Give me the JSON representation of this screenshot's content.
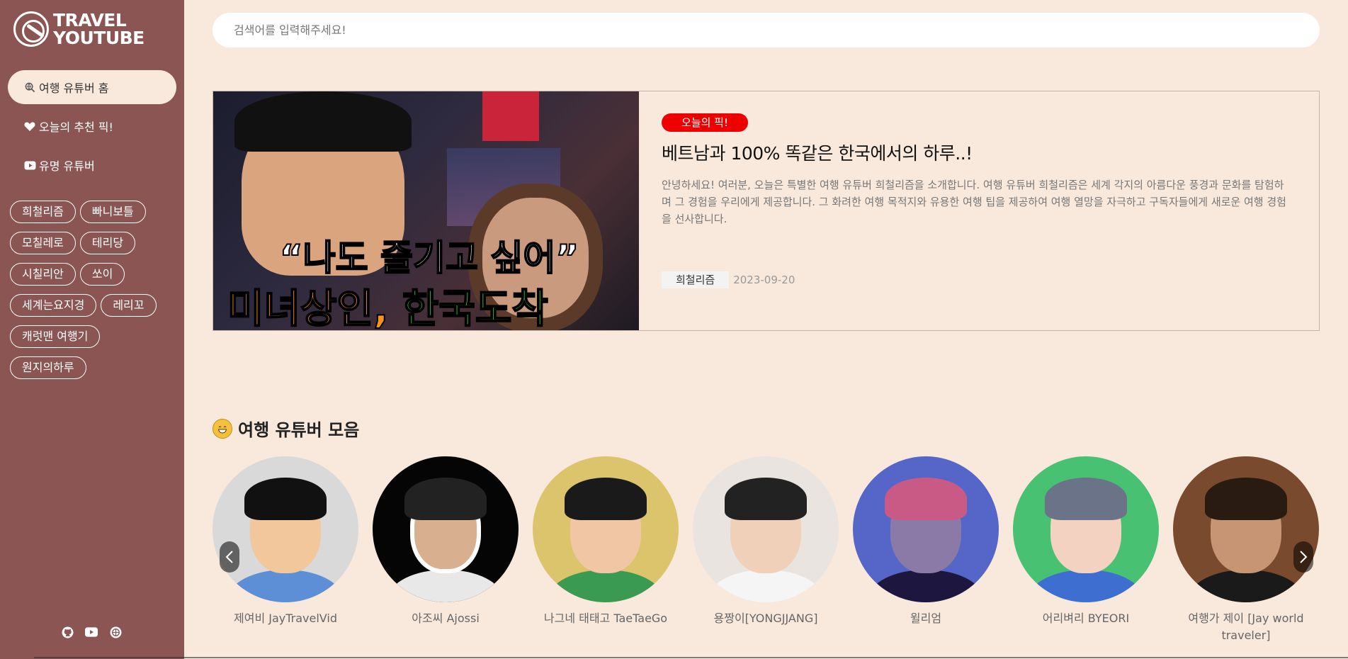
{
  "logo": {
    "line1": "TRAVEL",
    "line2": "YOUTUBE"
  },
  "nav": [
    {
      "label": "여행 유튜버 홈",
      "icon": "search-globe-icon",
      "active": true
    },
    {
      "label": "오늘의 추천 픽!",
      "icon": "heart-icon",
      "active": false
    },
    {
      "label": "유명 유튜버",
      "icon": "youtube-icon",
      "active": false
    }
  ],
  "tags": [
    "희철리즘",
    "빠니보틀",
    "모칠레로",
    "테리당",
    "시칠리안",
    "쏘이",
    "세계는요지경",
    "레리꼬",
    "캐럿맨 여행기",
    "원지의하루"
  ],
  "social": [
    "github-icon",
    "youtube-icon",
    "globe-icon"
  ],
  "search": {
    "placeholder": "검색어를 입력해주세요!",
    "value": ""
  },
  "featured": {
    "badge": "오늘의 픽!",
    "title": "베트남과 100% 똑같은 한국에서의 하루..!",
    "description": "안녕하세요! 여러분, 오늘은 특별한 여행 유튜버 희철리즘을 소개합니다. 여행 유튜버 희철리즘은 세계 각지의 아름다운 풍경과 문화를 탐험하며 그 경험을 우리에게 제공합니다. 그 화려한 여행 목적지와 유용한 여행 팁을 제공하여 여행 열망을 자극하고 구독자들에게 새로운 여행 경험을 선사합니다.",
    "channel": "희철리즘",
    "date": "2023-09-20",
    "thumb_caption_1": "“나도 즐기고 싶어”",
    "thumb_caption_2a": "미녀상인, ",
    "thumb_caption_2b": "한국도착"
  },
  "section": {
    "title": "여행 유튜버 모음",
    "emoji": "grinning-face-icon"
  },
  "youtubers": [
    {
      "name": "제여비 JayTravelVid",
      "bg": "#d9d9d9"
    },
    {
      "name": "아조씨 Ajossi",
      "bg": "#050505"
    },
    {
      "name": "나그네 태태고 TaeTaeGo",
      "bg": "#dcc46c"
    },
    {
      "name": "용짱이[YONGJJANG]",
      "bg": "#e9e4df"
    },
    {
      "name": "윌리엄",
      "bg": "#5566c8"
    },
    {
      "name": "어리벼리 BYEORI",
      "bg": "#48c272"
    },
    {
      "name": "여행가 제이 [Jay world traveler]",
      "bg": "#7a4a2e"
    }
  ]
}
